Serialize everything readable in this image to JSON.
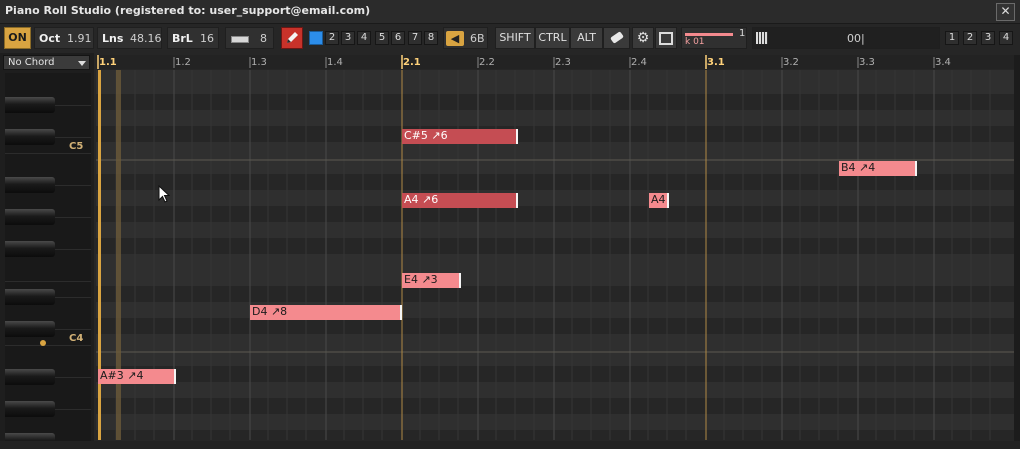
{
  "window": {
    "title": "Piano Roll Studio  (registered to: user_support@email.com)",
    "close": "✕"
  },
  "toolbar": {
    "on": "ON",
    "oct_label": "Oct",
    "oct_value": "1.91",
    "lns_label": "Lns",
    "lns_value": "48.16",
    "brl_label": "BrL",
    "brl_value": "16",
    "velocity_value": "8",
    "channels": [
      "2",
      "3",
      "4",
      "5",
      "6",
      "7",
      "8"
    ],
    "volume_value": "6B",
    "modifiers": [
      "SHIFT",
      "CTRL",
      "ALT"
    ],
    "track_number": "1",
    "track_name": "k 01",
    "field_value": "00|",
    "slots": [
      "1",
      "2",
      "3",
      "4"
    ]
  },
  "sidebar": {
    "chord_select": "No Chord",
    "octave_labels": [
      "C5",
      "C4"
    ]
  },
  "ruler": {
    "ticks": [
      "1.1",
      "1.2",
      "1.3",
      "1.4",
      "2.1",
      "2.2",
      "2.3",
      "2.4",
      "3.1",
      "3.2",
      "3.3",
      "3.4"
    ]
  },
  "notes": [
    {
      "label": "C#5 ↗6",
      "selected": true
    },
    {
      "label": "B4 ↗4",
      "selected": false
    },
    {
      "label": "A4 ↗6",
      "selected": true
    },
    {
      "label": "A4",
      "selected": false
    },
    {
      "label": "E4 ↗3",
      "selected": false
    },
    {
      "label": "D4 ↗8",
      "selected": false
    },
    {
      "label": "A#3 ↗4",
      "selected": false
    }
  ],
  "colors": {
    "accent": "#d9a441",
    "note_selected": "#c54d53",
    "note_unselected": "#f48a8e",
    "grid_bg": "#2f2f2f"
  },
  "icons": [
    "pencil-icon",
    "speaker-icon",
    "eraser-icon",
    "gear-icon",
    "copy-icon",
    "piano-keys-icon",
    "close-icon",
    "dropdown-arrow-icon",
    "mouse-pointer-icon"
  ]
}
